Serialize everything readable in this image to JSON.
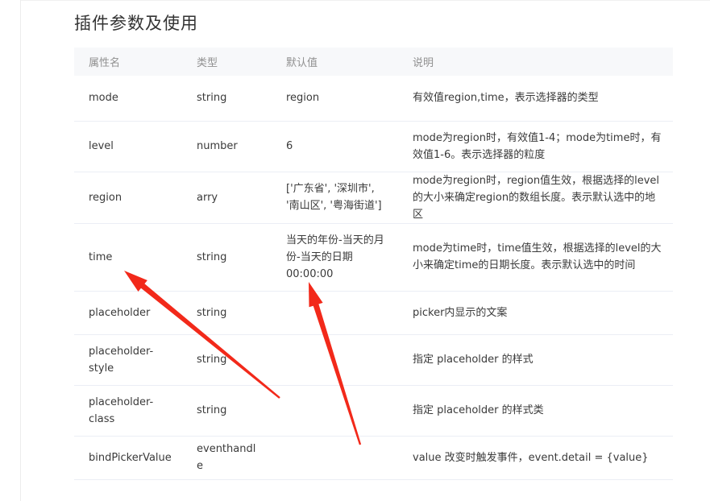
{
  "section": {
    "title": "插件参数及使用"
  },
  "table": {
    "headers": [
      "属性名",
      "类型",
      "默认值",
      "说明"
    ],
    "rows": [
      {
        "name": "mode",
        "type": "string",
        "default": "region",
        "desc": "有效值region,time，表示选择器的类型"
      },
      {
        "name": "level",
        "type": "number",
        "default": "6",
        "desc": "mode为region时，有效值1-4；mode为time时，有效值1-6。表示选择器的粒度"
      },
      {
        "name": "region",
        "type": "arry",
        "default": "['广东省', '深圳市', '南山区', '粤海街道']",
        "desc": "mode为region时，region值生效，根据选择的level的大小来确定region的数组长度。表示默认选中的地区"
      },
      {
        "name": "time",
        "type": "string",
        "default": "当天的年份-当天的月份-当天的日期 00:00:00",
        "desc": "mode为time时，time值生效，根据选择的level的大小来确定time的日期长度。表示默认选中的时间"
      },
      {
        "name": "placeholder",
        "type": "string",
        "default": "",
        "desc": "picker内显示的文案"
      },
      {
        "name": "placeholder-style",
        "type": "string",
        "default": "",
        "desc": "指定 placeholder 的样式"
      },
      {
        "name": "placeholder-class",
        "type": "string",
        "default": "",
        "desc": "指定 placeholder 的样式类"
      },
      {
        "name": "bindPickerValue",
        "type": "eventhandle",
        "default": "",
        "desc": "value 改变时触发事件，event.detail = {value}"
      }
    ]
  },
  "annotations": {
    "arrow_color": "#f2291a"
  }
}
